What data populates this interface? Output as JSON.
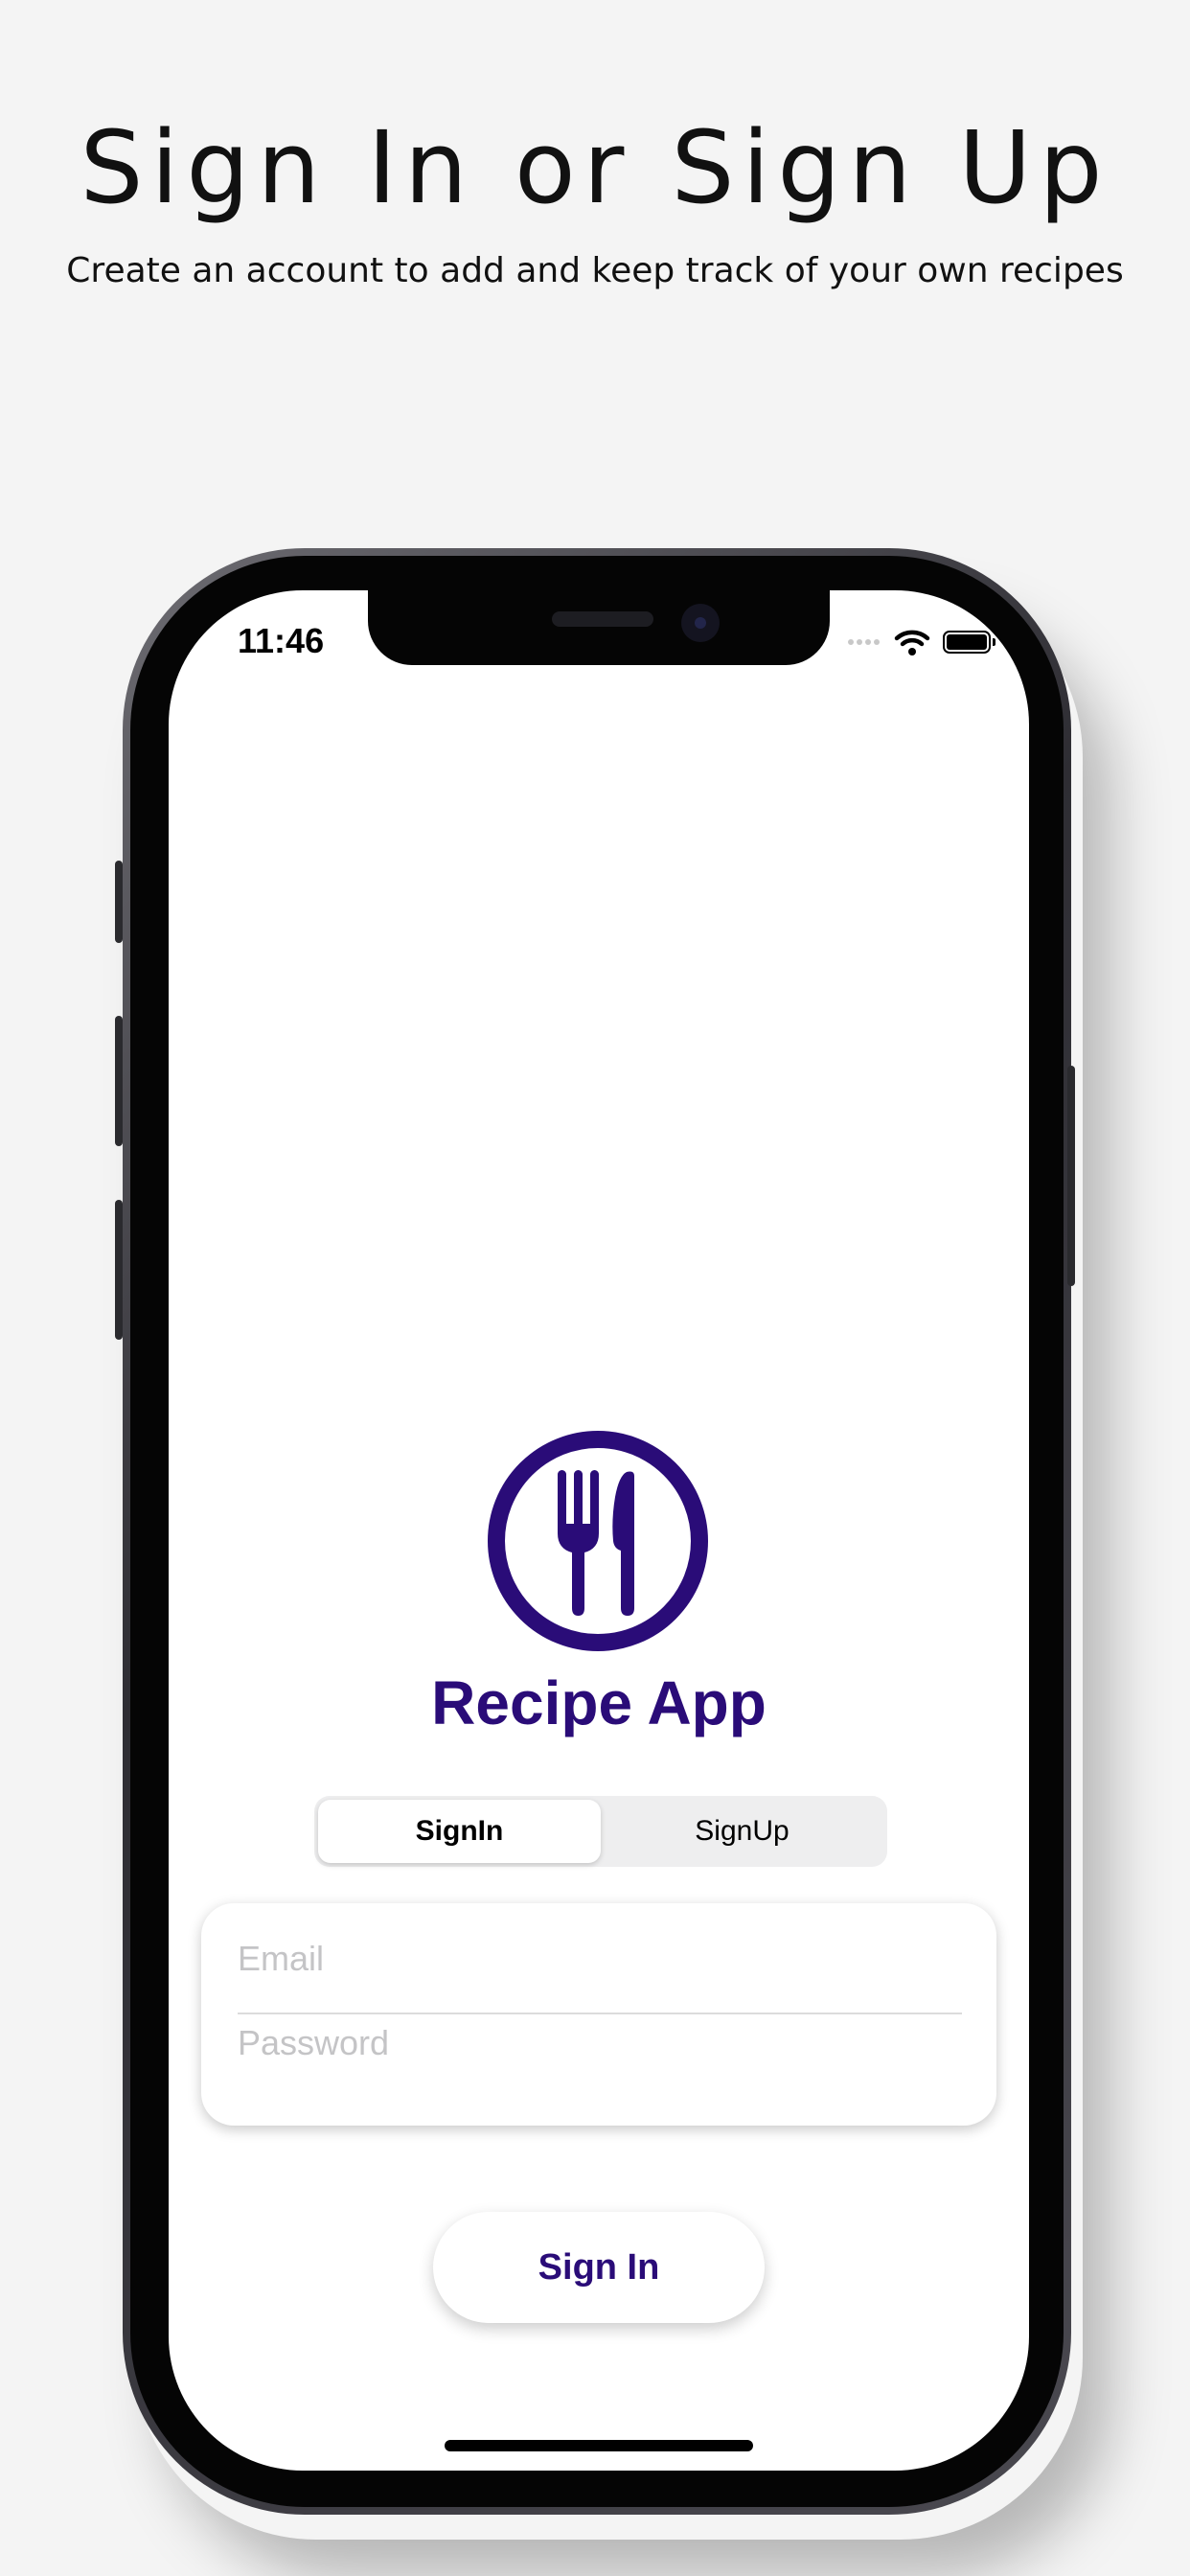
{
  "promo": {
    "title": "Sign In or Sign Up",
    "subtitle": "Create an account to add and keep track of your own recipes"
  },
  "status_bar": {
    "time": "11:46"
  },
  "app": {
    "title": "Recipe App",
    "logo_icon": "fork-knife-icon",
    "brand_color": "#2a0c78"
  },
  "segmented_control": {
    "options": [
      "SignIn",
      "SignUp"
    ],
    "selected": "SignIn"
  },
  "form": {
    "email": {
      "placeholder": "Email",
      "value": ""
    },
    "password": {
      "placeholder": "Password",
      "value": ""
    }
  },
  "actions": {
    "submit_label": "Sign In"
  }
}
